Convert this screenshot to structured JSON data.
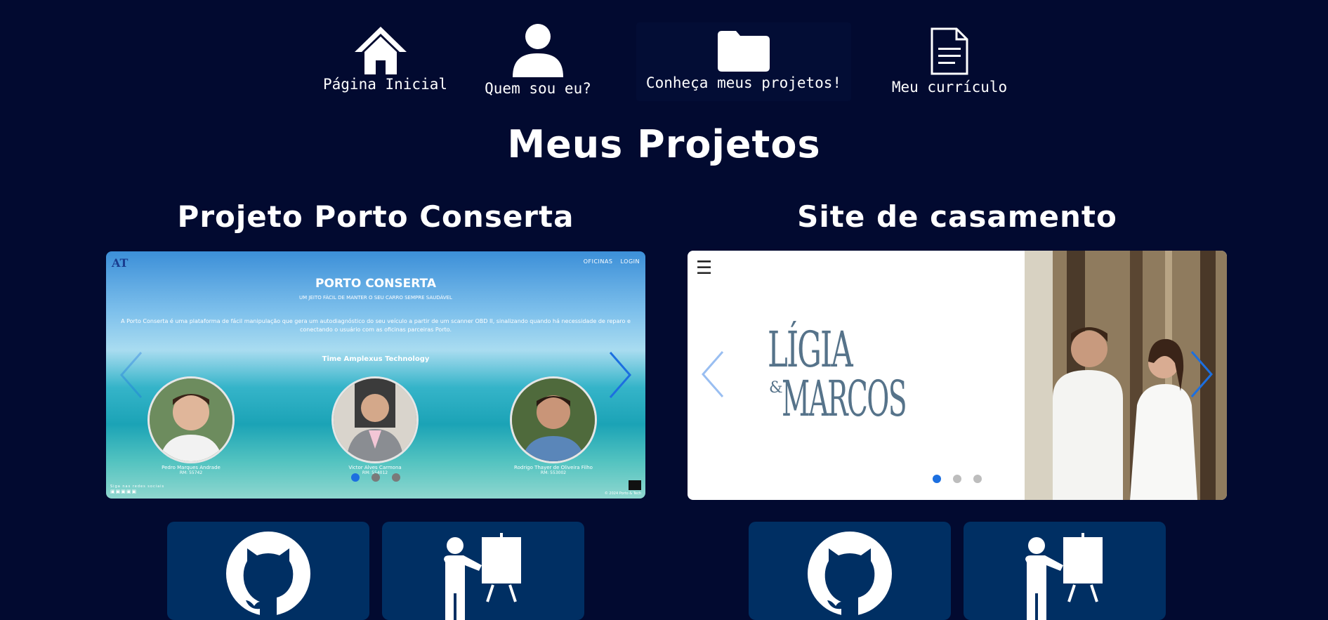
{
  "nav": {
    "home_label": "Página Inicial",
    "about_label": "Quem sou eu?",
    "projects_label": "Conheça meus projetos!",
    "cv_label": "Meu currículo"
  },
  "page": {
    "title": "Meus Projetos"
  },
  "projects": [
    {
      "title": "Projeto Porto Conserta",
      "slide": {
        "logo_text": "AT",
        "topnav": [
          "OFICINAS",
          "LOGIN"
        ],
        "site_title": "PORTO CONSERTA",
        "site_subtitle": "UM JEITO FÁCIL DE MANTER O SEU CARRO SEMPRE SAUDÁVEL",
        "description": "A Porto Conserta é uma plataforma de fácil manipulação que gera um autodiagnóstico do seu veículo a partir de um scanner OBD II, sinalizando quando há necessidade de reparo e conectando o usuário com as oficinas parceiras Porto.",
        "team_title": "Time Amplexus Technology",
        "members": [
          {
            "name": "Pedro Marques Andrade",
            "role": "RM: 55742"
          },
          {
            "name": "Victor Alves Carmona",
            "role": "RM: 554012"
          },
          {
            "name": "Rodrigo Thayer de Oliveira Filho",
            "role": "RM: 553002"
          }
        ],
        "footer_left": "Siga nas redes sociais",
        "footer_right": "© 2024 Porto & Tech"
      },
      "dots": 3,
      "active_dot": 0,
      "links": [
        "github-icon",
        "presentation-icon"
      ]
    },
    {
      "title": "Site de casamento",
      "slide": {
        "menu_icon": "☰",
        "name1": "LÍGIA",
        "ampersand": "&",
        "name2": "MARCOS"
      },
      "dots": 3,
      "active_dot": 0,
      "links": [
        "github-icon",
        "presentation-icon"
      ]
    }
  ],
  "colors": {
    "background": "#020a30",
    "card": "#002f63",
    "accent": "#1c6fe0"
  }
}
